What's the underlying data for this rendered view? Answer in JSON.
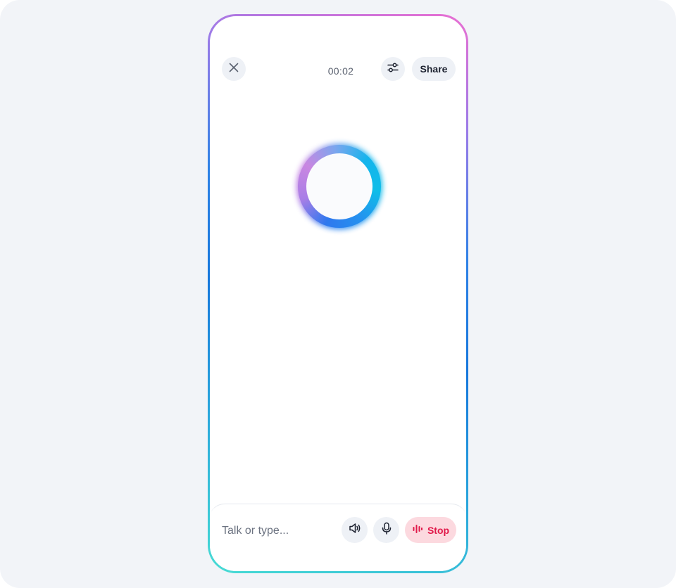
{
  "header": {
    "close_icon": "close-icon",
    "timer": "00:02",
    "settings_icon": "sliders-icon",
    "share_label": "Share"
  },
  "orb": {
    "colors": [
      "#2f78ee",
      "#c987e1",
      "#0fbde8"
    ]
  },
  "composer": {
    "placeholder": "Talk or type...",
    "speaker_icon": "speaker-icon",
    "mic_icon": "microphone-icon",
    "stop_icon": "waveform-icon",
    "stop_label": "Stop"
  },
  "colors": {
    "background": "#f2f4f8",
    "stop_bg": "#fcd9df",
    "stop_text": "#e1194a",
    "button_bg": "#eef1f6"
  }
}
